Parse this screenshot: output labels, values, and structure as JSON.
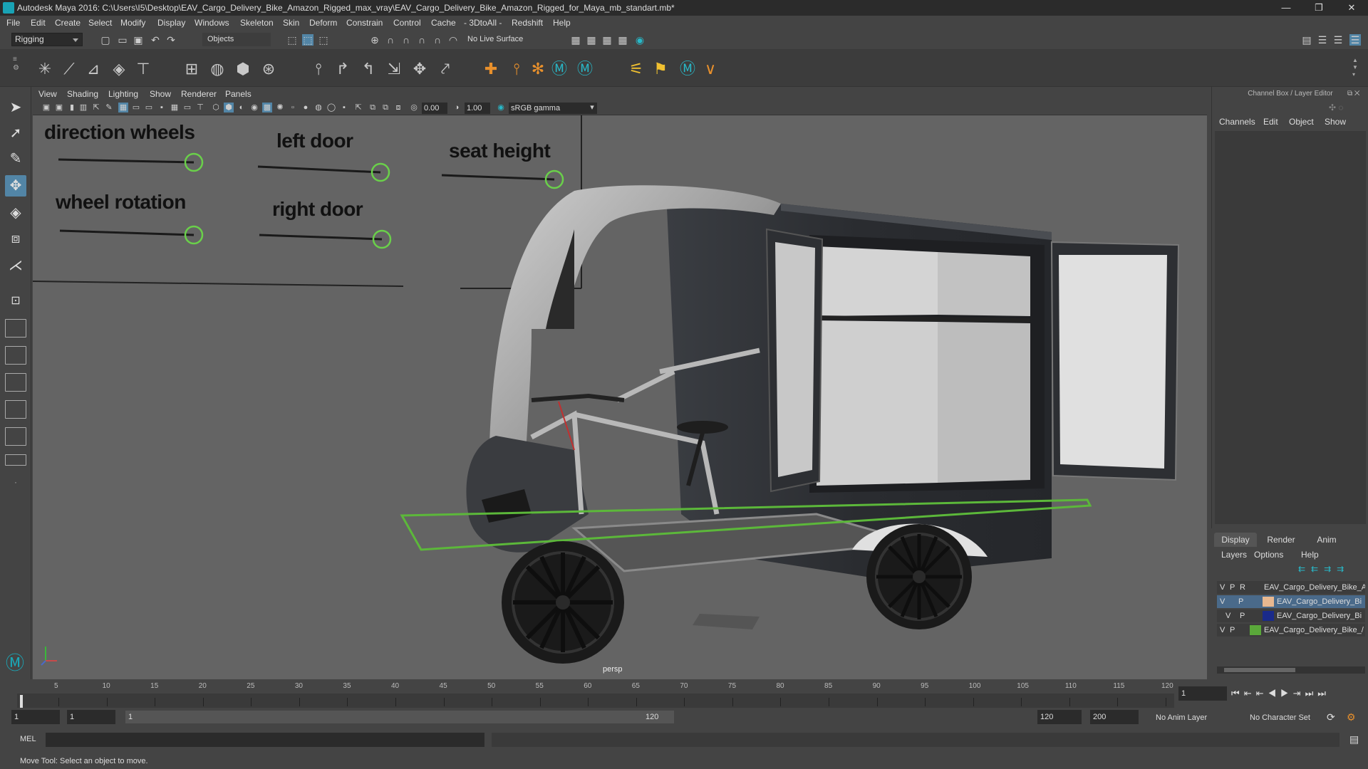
{
  "window": {
    "title": "Autodesk Maya 2016: C:\\Users\\I5\\Desktop\\EAV_Cargo_Delivery_Bike_Amazon_Rigged_max_vray\\EAV_Cargo_Delivery_Bike_Amazon_Rigged_for_Maya_mb_standart.mb*",
    "minimize": "—",
    "maximize": "❐",
    "close": "✕"
  },
  "menubar": [
    "File",
    "Edit",
    "Create",
    "Select",
    "Modify",
    "Display",
    "Windows",
    "Skeleton",
    "Skin",
    "Deform",
    "Constrain",
    "Control",
    "Cache",
    "- 3DtoAll -",
    "Redshift",
    "Help"
  ],
  "statusline": {
    "mode": "Rigging",
    "selection_mode": "Objects",
    "live_surface": "No Live Surface"
  },
  "viewport": {
    "menu": [
      "View",
      "Shading",
      "Lighting",
      "Show",
      "Renderer",
      "Panels"
    ],
    "near_value": "0.00",
    "far_value": "1.00",
    "color_space": "sRGB gamma",
    "camera": "persp",
    "controls": {
      "direction_wheels": "direction wheels",
      "left_door": "left door",
      "seat_height": "seat height",
      "wheel_rotation": "wheel rotation",
      "right_door": "right door"
    }
  },
  "channelbox": {
    "header": "Channel Box / Layer Editor",
    "menu": [
      "Channels",
      "Edit",
      "Object",
      "Show"
    ]
  },
  "layers": {
    "tabs": [
      "Display",
      "Render",
      "Anim"
    ],
    "menu": [
      "Layers",
      "Options",
      "Help"
    ],
    "rows": [
      {
        "v": "V",
        "p": "P",
        "r": "R",
        "name": "EAV_Cargo_Delivery_Bike_Am",
        "color": "#3c3c3c"
      },
      {
        "v": "V",
        "p": "P",
        "r": "",
        "name": "EAV_Cargo_Delivery_Bi",
        "color": "#e8b890"
      },
      {
        "v": "V",
        "p": "P",
        "r": "",
        "name": "EAV_Cargo_Delivery_Bi",
        "color": "#1a2a8a"
      },
      {
        "v": "V",
        "p": "P",
        "r": "",
        "name": "EAV_Cargo_Delivery_Bike_/",
        "color": "#5aa83a"
      }
    ]
  },
  "timeline": {
    "ticks": [
      "1",
      "5",
      "10",
      "15",
      "20",
      "25",
      "30",
      "35",
      "40",
      "45",
      "50",
      "55",
      "60",
      "65",
      "70",
      "75",
      "80",
      "85",
      "90",
      "95",
      "100",
      "105",
      "110",
      "115",
      "120"
    ],
    "current_frame": "1"
  },
  "range": {
    "start": "1",
    "playback_start": "1",
    "slider_start": "1",
    "slider_end": "120",
    "playback_end": "120",
    "end": "200",
    "anim_layer": "No Anim Layer",
    "character_set": "No Character Set"
  },
  "mel": {
    "label": "MEL"
  },
  "helpline": "Move Tool: Select an object to move."
}
